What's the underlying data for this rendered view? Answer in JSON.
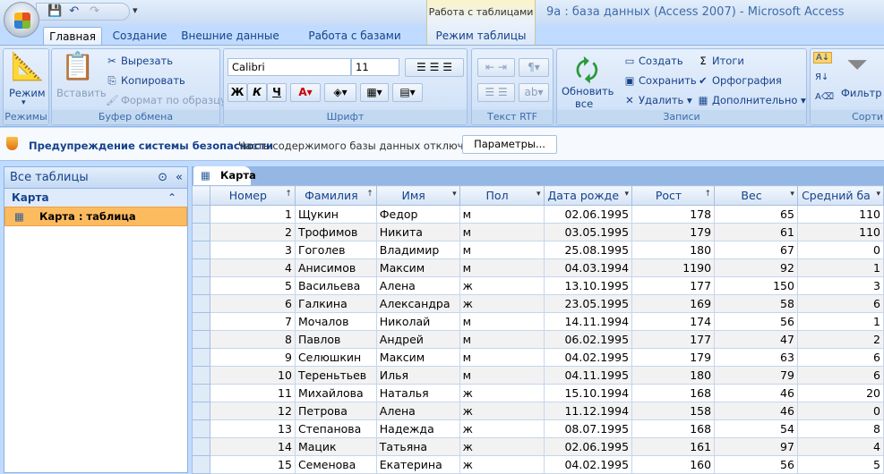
{
  "window": {
    "title": "9а : база данных (Access 2007) - Microsoft Access",
    "context_tab": "Работа с таблицами"
  },
  "tabs": [
    "Главная",
    "Создание",
    "Внешние данные",
    "Работа с базами данных",
    "Режим таблицы"
  ],
  "ribbon": {
    "modes": {
      "view": "Режим",
      "label": "Режимы"
    },
    "clipboard": {
      "paste": "Вставить",
      "cut": "Вырезать",
      "copy": "Копировать",
      "format_painter": "Формат по образцу",
      "label": "Буфер обмена"
    },
    "font": {
      "name": "Calibri",
      "size": "11",
      "bold": "Ж",
      "italic": "К",
      "underline": "Ч",
      "label": "Шрифт"
    },
    "rtf": {
      "label": "Текст RTF"
    },
    "records": {
      "refresh": "Обновить",
      "refresh2": "все",
      "new": "Создать",
      "save": "Сохранить",
      "delete": "Удалить",
      "totals": "Итоги",
      "spelling": "Орфография",
      "more": "Дополнительно",
      "label": "Записи"
    },
    "sort": {
      "filter": "Фильтр",
      "label": "Сортир"
    }
  },
  "security": {
    "title": "Предупреждение системы безопасности",
    "message": "Часть содержимого базы данных отключено",
    "button": "Параметры..."
  },
  "nav": {
    "header": "Все таблицы",
    "group": "Карта",
    "item": "Карта : таблица"
  },
  "document": {
    "tab": "Карта",
    "columns": [
      "Номер",
      "Фамилия",
      "Имя",
      "Пол",
      "Дата рожде",
      "Рост",
      "Вес",
      "Средний ба"
    ],
    "rows": [
      [
        "1",
        "Щукин",
        "Федор",
        "м",
        "02.06.1995",
        "178",
        "65",
        "110"
      ],
      [
        "2",
        "Трофимов",
        "Никита",
        "м",
        "03.05.1995",
        "179",
        "61",
        "110"
      ],
      [
        "3",
        "Гоголев",
        "Владимир",
        "м",
        "25.08.1995",
        "180",
        "67",
        "0"
      ],
      [
        "4",
        "Анисимов",
        "Максим",
        "м",
        "04.03.1994",
        "1190",
        "92",
        "1"
      ],
      [
        "5",
        "Васильева",
        "Алена",
        "ж",
        "13.10.1995",
        "177",
        "150",
        "3"
      ],
      [
        "6",
        "Галкина",
        "Александра",
        "ж",
        "23.05.1995",
        "169",
        "58",
        "6"
      ],
      [
        "7",
        "Мочалов",
        "Николай",
        "м",
        "14.11.1994",
        "174",
        "56",
        "1"
      ],
      [
        "8",
        "Павлов",
        "Андрей",
        "м",
        "06.02.1995",
        "177",
        "47",
        "2"
      ],
      [
        "9",
        "Селюшкин",
        "Максим",
        "м",
        "04.02.1995",
        "179",
        "63",
        "6"
      ],
      [
        "10",
        "Тереньтьев",
        "Илья",
        "м",
        "04.11.1995",
        "180",
        "79",
        "6"
      ],
      [
        "11",
        "Михайлова",
        "Наталья",
        "ж",
        "15.10.1994",
        "168",
        "46",
        "20"
      ],
      [
        "12",
        "Петрова",
        "Алена",
        "ж",
        "11.12.1994",
        "158",
        "46",
        "0"
      ],
      [
        "13",
        "Степанова",
        "Надежда",
        "ж",
        "08.07.1995",
        "168",
        "54",
        "8"
      ],
      [
        "14",
        "Мацик",
        "Татьяна",
        "ж",
        "02.06.1995",
        "161",
        "97",
        "4"
      ],
      [
        "15",
        "Семенова",
        "Екатерина",
        "ж",
        "04.02.1995",
        "160",
        "56",
        "5"
      ]
    ]
  }
}
